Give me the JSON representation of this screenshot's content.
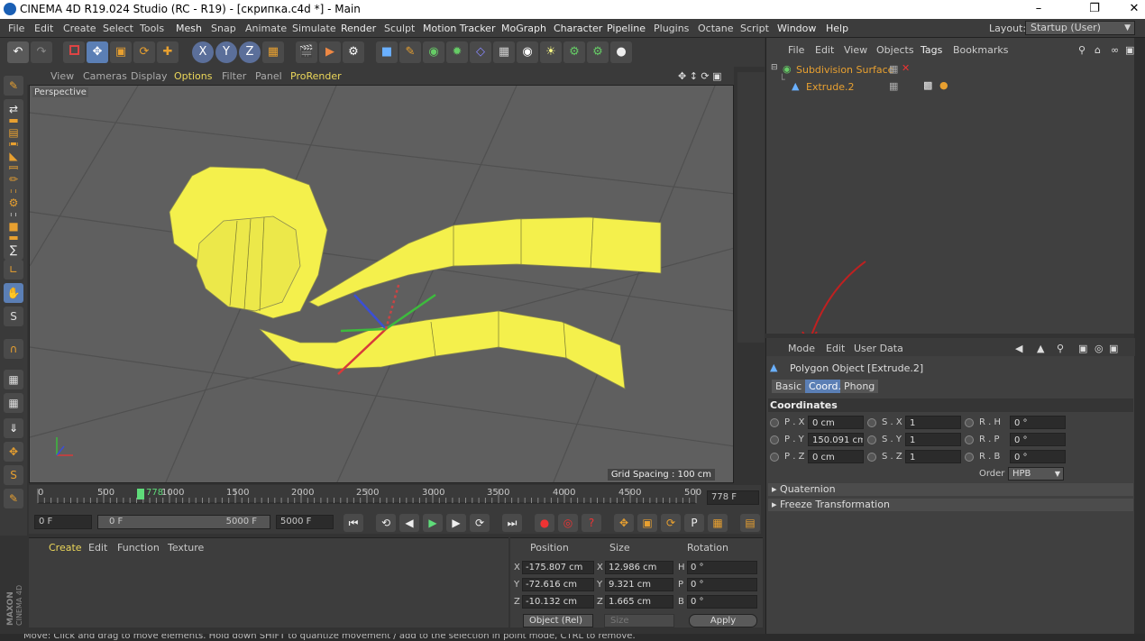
{
  "window": {
    "title": "CINEMA 4D R19.024 Studio (RC - R19) - [скрипка.c4d *] - Main"
  },
  "menubar": {
    "items": [
      "File",
      "Edit",
      "Create",
      "Select",
      "Tools",
      "Mesh",
      "Snap",
      "Animate",
      "Simulate",
      "Render",
      "Sculpt",
      "Motion Tracker",
      "MoGraph",
      "Character",
      "Pipeline",
      "Plugins",
      "Octane",
      "Script",
      "Window",
      "Help"
    ],
    "layout_label": "Layout:",
    "layout_value": "Startup (User)"
  },
  "viewport": {
    "menu": [
      "View",
      "Cameras",
      "Display",
      "Options",
      "Filter",
      "Panel",
      "ProRender"
    ],
    "camera": "Perspective",
    "grid_spacing": "Grid Spacing : 100 cm"
  },
  "object_manager": {
    "menu": [
      "File",
      "Edit",
      "View",
      "Objects",
      "Tags",
      "Bookmarks"
    ],
    "objects": [
      {
        "name": "Subdivision Surface"
      },
      {
        "name": "Extrude.2"
      }
    ]
  },
  "attribute_manager": {
    "menu": [
      "Mode",
      "Edit",
      "User Data"
    ],
    "object_title": "Polygon Object [Extrude.2]",
    "tabs": [
      "Basic",
      "Coord.",
      "Phong"
    ],
    "section": "Coordinates",
    "fields": {
      "px": {
        "label": "P . X",
        "value": "0 cm"
      },
      "py": {
        "label": "P . Y",
        "value": "150.091 cm"
      },
      "pz": {
        "label": "P . Z",
        "value": "0 cm"
      },
      "sx": {
        "label": "S . X",
        "value": "1"
      },
      "sy": {
        "label": "S . Y",
        "value": "1"
      },
      "sz": {
        "label": "S . Z",
        "value": "1"
      },
      "rh": {
        "label": "R . H",
        "value": "0 °"
      },
      "rp": {
        "label": "R . P",
        "value": "0 °"
      },
      "rb": {
        "label": "R . B",
        "value": "0 °"
      }
    },
    "order_label": "Order",
    "order_value": "HPB",
    "collapsed": [
      "Quaternion",
      "Freeze Transformation"
    ]
  },
  "timeline": {
    "ticks": [
      "0",
      "500",
      "1000",
      "1500",
      "2000",
      "2500",
      "3000",
      "3500",
      "4000",
      "4500",
      "500"
    ],
    "current": "778",
    "current_field": "778 F"
  },
  "playback": {
    "start": "0 F",
    "range_start": "0 F",
    "range_end": "5000 F",
    "end": "5000 F"
  },
  "material_manager": {
    "menu": [
      "Create",
      "Edit",
      "Function",
      "Texture"
    ]
  },
  "coordinates_manager": {
    "headers": [
      "Position",
      "Size",
      "Rotation"
    ],
    "rows": [
      {
        "axis": "X",
        "pos": "-175.807 cm",
        "size_axis": "X",
        "size": "12.986 cm",
        "rot_axis": "H",
        "rot": "0 °"
      },
      {
        "axis": "Y",
        "pos": "-72.616 cm",
        "size_axis": "Y",
        "size": "9.321 cm",
        "rot_axis": "P",
        "rot": "0 °"
      },
      {
        "axis": "Z",
        "pos": "-10.132 cm",
        "size_axis": "Z",
        "size": "1.665 cm",
        "rot_axis": "B",
        "rot": "0 °"
      }
    ],
    "mode": "Object (Rel)",
    "size_mode": "Size",
    "apply": "Apply"
  },
  "status": {
    "text": "Move: Click and drag to move elements. Hold down SHIFT to quantize movement / add to the selection in point mode, CTRL to remove."
  },
  "brand": {
    "line1": "MAXON",
    "line2": "CINEMA 4D"
  },
  "colors": {
    "accent": "#e8a030",
    "selection": "#5b7fb5",
    "object": "#f4f04c"
  }
}
